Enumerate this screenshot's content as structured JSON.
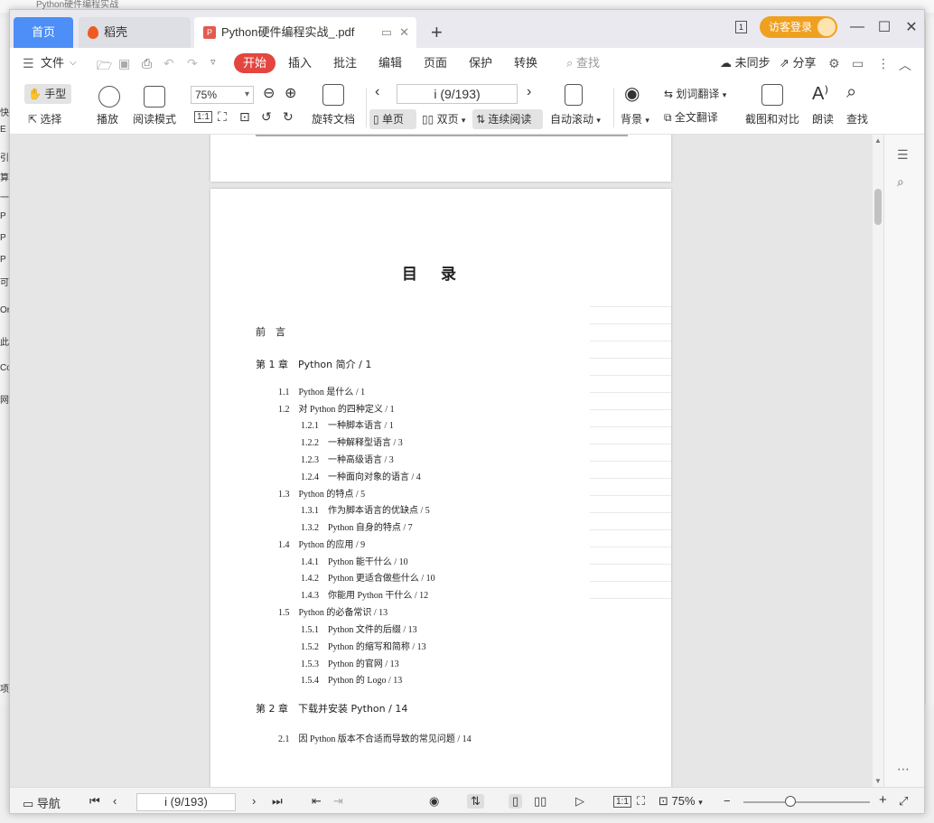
{
  "window": {
    "desktop_title_fragment": "Python硬件编程实战",
    "tabs": {
      "home": "首页",
      "daoke": "稻壳",
      "document": "Python硬件编程实战_.pdf"
    },
    "guest_login": "访客登录",
    "badge_number": "1"
  },
  "desktop_left_glyphs": [
    "快",
    "E",
    "引",
    "算",
    "一",
    "P",
    "P",
    "P",
    "可",
    "Or",
    "此",
    "Co",
    "网",
    "项"
  ],
  "menu": {
    "file": "文件",
    "start": "开始",
    "insert": "插入",
    "annotate": "批注",
    "edit": "编辑",
    "page": "页面",
    "protect": "保护",
    "convert": "转换",
    "search": "查找",
    "unsynced": "未同步",
    "share": "分享"
  },
  "toolbar": {
    "hand": "手型",
    "select": "选择",
    "play": "播放",
    "read_mode": "阅读模式",
    "zoom": "75%",
    "rotate_doc": "旋转文档",
    "page_indicator": "i (9/193)",
    "single_page": "单页",
    "double_page": "双页",
    "continuous": "连续阅读",
    "auto_scroll": "自动滚动",
    "background": "背景",
    "word_translate": "划词翻译",
    "full_translate": "全文翻译",
    "crop_compare": "截图和对比",
    "read_aloud": "朗读",
    "find": "查找",
    "one_to_one": "1:1"
  },
  "document": {
    "toc_title": "目录",
    "toc": [
      {
        "level": 0,
        "text": "前　言"
      },
      {
        "level": 0,
        "text": "第 1 章　Python 简介 / 1"
      },
      {
        "level": 1,
        "text": "1.1　Python 是什么 / 1"
      },
      {
        "level": 1,
        "text": "1.2　对 Python 的四种定义 / 1"
      },
      {
        "level": 2,
        "text": "1.2.1　一种脚本语言 / 1"
      },
      {
        "level": 2,
        "text": "1.2.2　一种解释型语言 / 3"
      },
      {
        "level": 2,
        "text": "1.2.3　一种高级语言 / 3"
      },
      {
        "level": 2,
        "text": "1.2.4　一种面向对象的语言 / 4"
      },
      {
        "level": 1,
        "text": "1.3　Python 的特点 / 5"
      },
      {
        "level": 2,
        "text": "1.3.1　作为脚本语言的优缺点 / 5"
      },
      {
        "level": 2,
        "text": "1.3.2　Python 自身的特点 / 7"
      },
      {
        "level": 1,
        "text": "1.4　Python 的应用 / 9"
      },
      {
        "level": 2,
        "text": "1.4.1　Python 能干什么 / 10"
      },
      {
        "level": 2,
        "text": "1.4.2　Python 更适合做些什么 / 10"
      },
      {
        "level": 2,
        "text": "1.4.3　你能用 Python 干什么 / 12"
      },
      {
        "level": 1,
        "text": "1.5　Python 的必备常识 / 13"
      },
      {
        "level": 2,
        "text": "1.5.1　Python 文件的后缀 / 13"
      },
      {
        "level": 2,
        "text": "1.5.2　Python 的缩写和简称 / 13"
      },
      {
        "level": 2,
        "text": "1.5.3　Python 的官网 / 13"
      },
      {
        "level": 2,
        "text": "1.5.4　Python 的 Logo / 13"
      },
      {
        "level": 0,
        "text": "第 2 章　下载并安装 Python / 14"
      },
      {
        "level": 1,
        "text": "2.1　因 Python 版本不合适而导致的常见问题 / 14"
      }
    ]
  },
  "statusbar": {
    "nav": "导航",
    "page_indicator": "i (9/193)",
    "zoom": "75%",
    "one_to_one": "1:1"
  },
  "colors": {
    "home_tab": "#4d8ef7",
    "start_pill": "#e2463f",
    "guest_login": "#f0a020"
  }
}
